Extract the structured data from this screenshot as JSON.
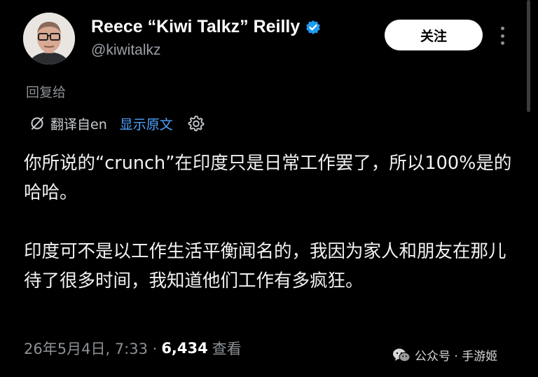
{
  "author": {
    "display_name": "Reece “Kiwi Talkz” Reilly",
    "handle": "@kiwitalkz",
    "verified": true
  },
  "actions": {
    "follow_label": "关注"
  },
  "reply_label": "回复给",
  "translation": {
    "translated_from": "翻译自en",
    "show_original": "显示原文"
  },
  "tweet": {
    "paragraphs": [
      "你所说的“crunch”在印度只是日常工作罢了，所以100%是的哈哈。",
      "印度可不是以工作生活平衡闻名的，我因为家人和朋友在那儿待了很多时间，我知道他们工作有多疯狂。"
    ]
  },
  "meta": {
    "timestamp": "26年5月4日, 7:33 ·",
    "views_count": "6,434",
    "views_label": "查看"
  },
  "watermark": {
    "text": "公众号 · 手游姬"
  },
  "colors": {
    "background": "#000000",
    "link": "#4ea3ff",
    "verified_badge": "#1d9bf0",
    "muted_text": "#8b9196"
  }
}
